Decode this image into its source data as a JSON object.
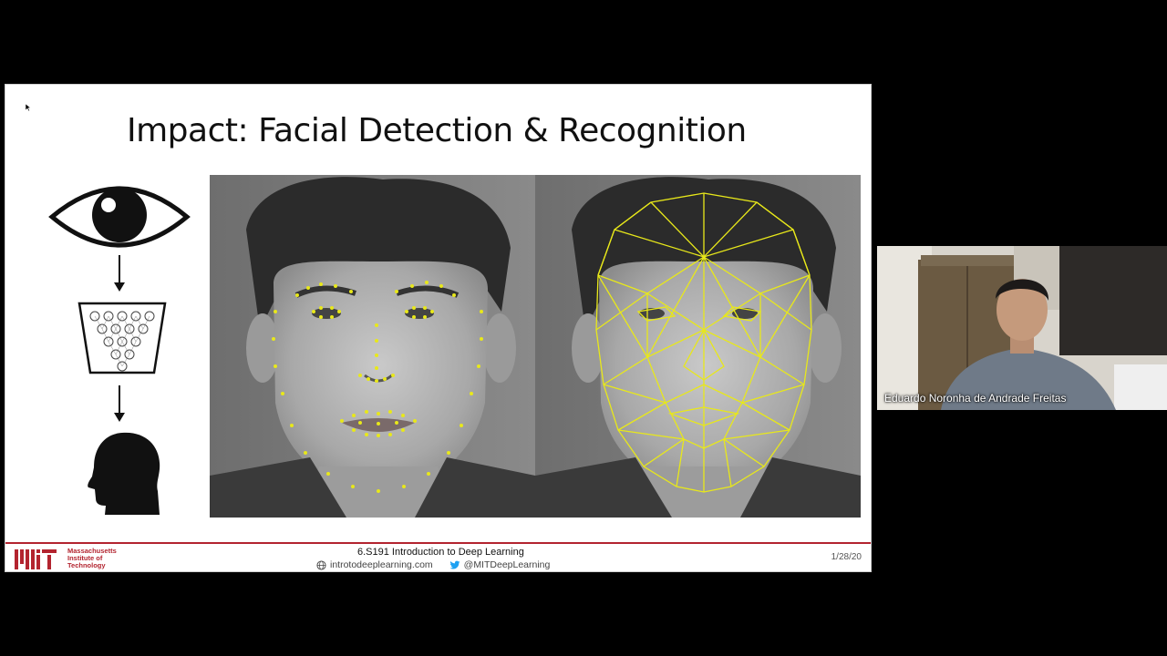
{
  "slide": {
    "title": "Impact: Facial Detection & Recognition",
    "footer": {
      "institution": [
        "Massachusetts",
        "Institute of",
        "Technology"
      ],
      "course_title": "6.S191 Introduction to Deep Learning",
      "website": "introtodeeplearning.com",
      "twitter": "@MITDeepLearning",
      "date": "1/28/20"
    },
    "pipeline_icons": [
      "eye-icon",
      "neural-network-icon",
      "head-silhouette-icon"
    ]
  },
  "participant": {
    "name": "Eduardo Noronha de Andrade Freitas"
  },
  "colors": {
    "background": "#000000",
    "slide_background": "#ffffff",
    "mit_red": "#b3242f",
    "landmark_yellow": "#e8e81a",
    "twitter_blue": "#1da1f2"
  }
}
